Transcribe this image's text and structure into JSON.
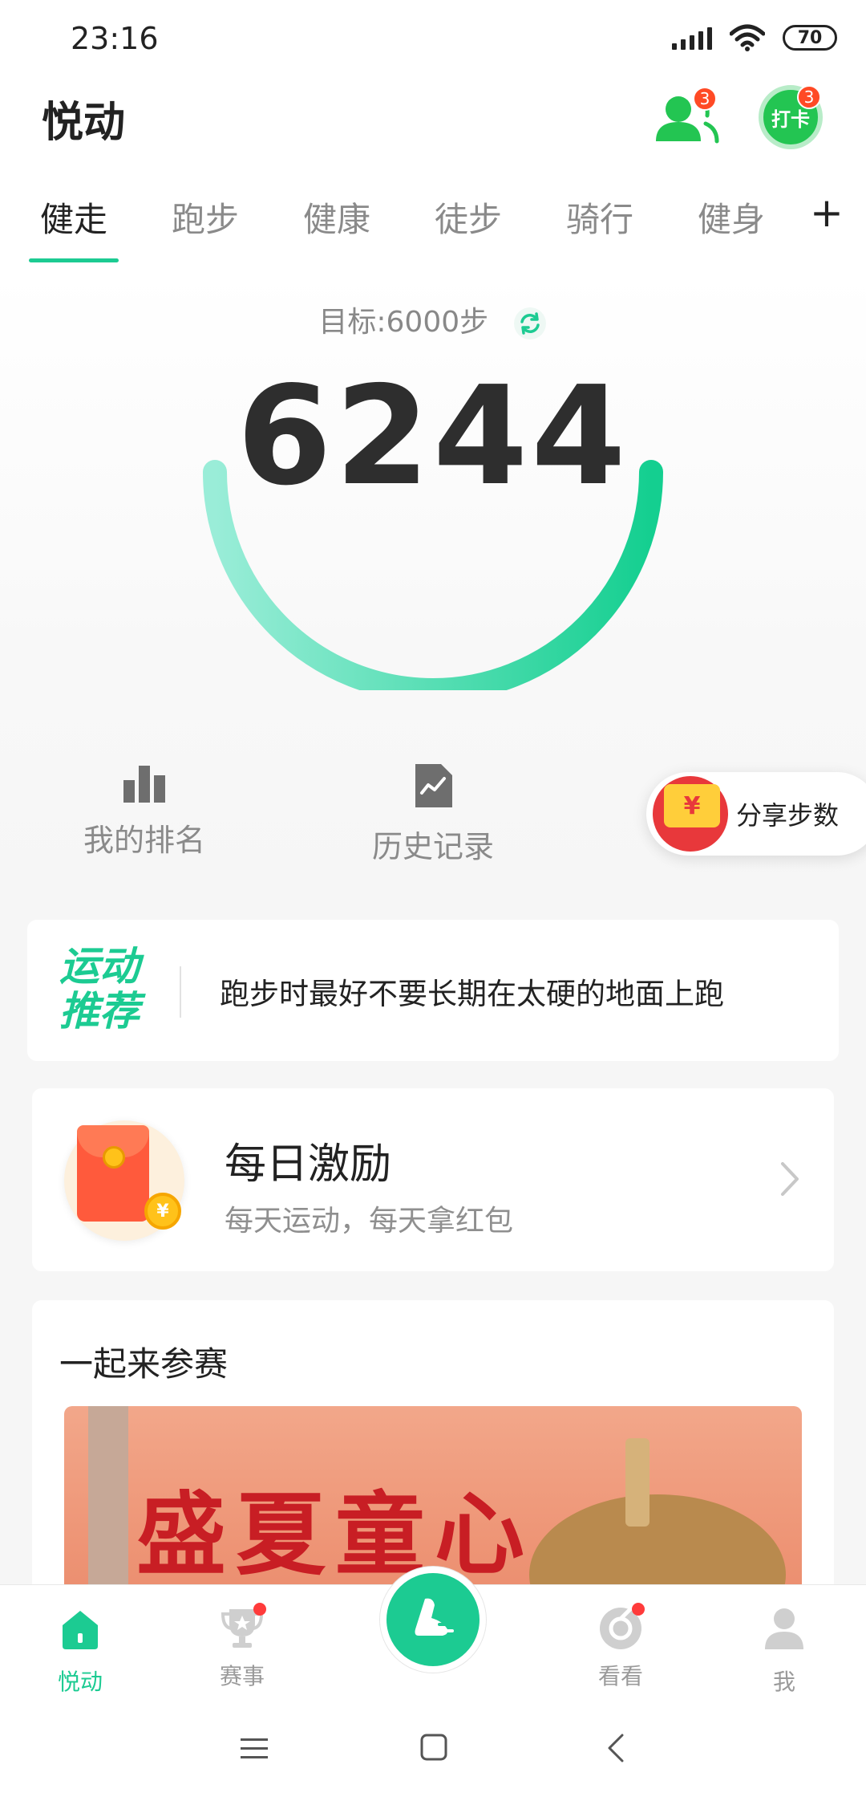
{
  "status_bar": {
    "time": "23:16",
    "battery": "70"
  },
  "header": {
    "title": "悦动",
    "friends_badge": "3",
    "checkin_label": "打卡",
    "checkin_badge": "3"
  },
  "tabs": [
    {
      "label": "健走"
    },
    {
      "label": "跑步"
    },
    {
      "label": "健康"
    },
    {
      "label": "徒步"
    },
    {
      "label": "骑行"
    },
    {
      "label": "健身"
    }
  ],
  "tab_add": "+",
  "progress": {
    "goal_text": "目标:6000步",
    "steps": "6244",
    "goal": 6000,
    "value": 6244,
    "ring_color_start": "#9aedd8",
    "ring_color_end": "#14cf90"
  },
  "quick_actions": {
    "ranking": "我的排名",
    "history": "历史记录",
    "share": "分享步数",
    "share_symbol": "¥"
  },
  "recommendation": {
    "logo_line1": "运动",
    "logo_line2": "推荐",
    "tip": "跑步时最好不要长期在太硬的地面上跑"
  },
  "daily_reward": {
    "title": "每日激励",
    "subtitle": "每天运动，每天拿红包",
    "coin_symbol": "¥"
  },
  "competition": {
    "title": "一起来参赛",
    "banner_text": "盛夏童心"
  },
  "bottom_nav": [
    {
      "label": "悦动",
      "icon": "home-icon"
    },
    {
      "label": "赛事",
      "icon": "trophy-icon"
    },
    {
      "label": "",
      "icon": "run-shoe-icon"
    },
    {
      "label": "看看",
      "icon": "discover-icon"
    },
    {
      "label": "我",
      "icon": "person-icon"
    }
  ],
  "colors": {
    "accent": "#1ccb92",
    "badge": "#ff4a25",
    "checkin": "#23c552"
  }
}
